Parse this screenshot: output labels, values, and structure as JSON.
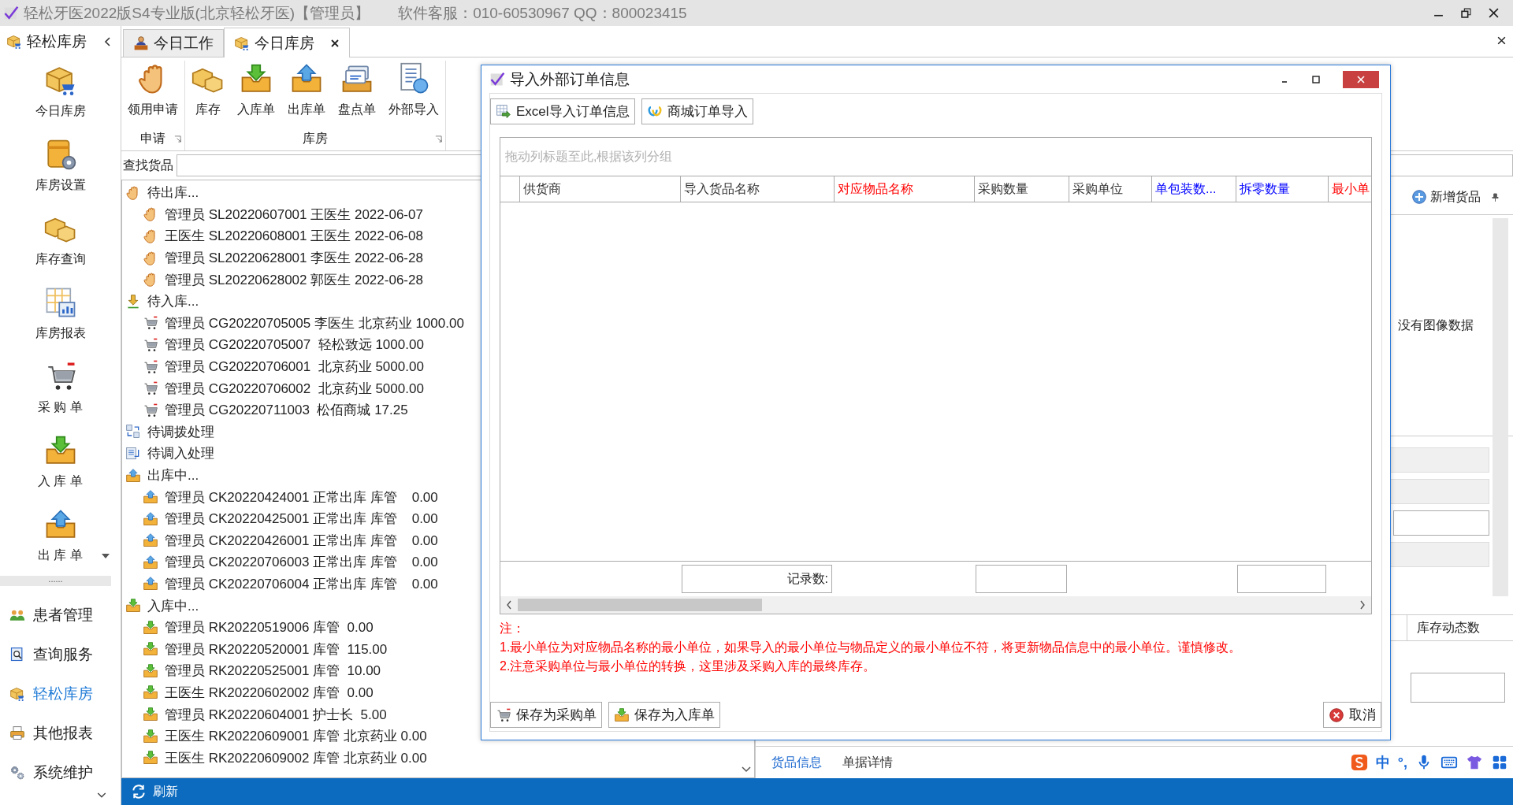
{
  "window": {
    "title": "轻松牙医2022版S4专业版(北京轻松牙医)【管理员】",
    "support": "软件客服：010-60530967  QQ：800023415"
  },
  "sidebar": {
    "header": "轻松库房",
    "big_items": [
      {
        "label": "今日库房",
        "kind": "box-cart",
        "dropdown": false
      },
      {
        "label": "库房设置",
        "kind": "box-gear",
        "dropdown": false
      },
      {
        "label": "库存查询",
        "kind": "boxes",
        "dropdown": false
      },
      {
        "label": "库房报表",
        "kind": "report",
        "dropdown": false
      },
      {
        "label": "采 购 单",
        "kind": "cart",
        "dropdown": false
      },
      {
        "label": "入 库 单",
        "kind": "tray-in",
        "dropdown": false
      },
      {
        "label": "出 库 单",
        "kind": "tray-out",
        "dropdown": true
      }
    ],
    "splitter": "......",
    "nav_items": [
      {
        "label": "患者管理",
        "kind": "people",
        "selected": false
      },
      {
        "label": "查询服务",
        "kind": "search-doc",
        "selected": false
      },
      {
        "label": "轻松库房",
        "kind": "box-cart",
        "selected": true
      },
      {
        "label": "其他报表",
        "kind": "printer",
        "selected": false
      },
      {
        "label": "系统维护",
        "kind": "gears",
        "selected": false
      }
    ]
  },
  "tabs": [
    {
      "label": "今日工作",
      "kind": "person",
      "selected": false,
      "closable": false
    },
    {
      "label": "今日库房",
      "kind": "box-cart",
      "selected": true,
      "closable": true
    }
  ],
  "ribbon": {
    "groups": [
      {
        "title": "申请",
        "buttons": [
          {
            "label": "领用申请",
            "kind": "hand"
          }
        ]
      },
      {
        "title": "库房",
        "buttons": [
          {
            "label": "库存",
            "kind": "boxes"
          },
          {
            "label": "入库单",
            "kind": "tray-in"
          },
          {
            "label": "出库单",
            "kind": "tray-out"
          },
          {
            "label": "盘点单",
            "kind": "tags"
          },
          {
            "label": "外部导入",
            "kind": "doc-circle"
          }
        ]
      }
    ]
  },
  "search": {
    "label": "查找货品"
  },
  "tree": [
    {
      "label": "待出库...",
      "kind": "hand",
      "children": [
        {
          "label": "管理员 SL20220607001 王医生 2022-06-07",
          "kind": "hand"
        },
        {
          "label": "王医生 SL20220608001 王医生 2022-06-08",
          "kind": "hand"
        },
        {
          "label": "管理员 SL20220628001 李医生 2022-06-28",
          "kind": "hand"
        },
        {
          "label": "管理员 SL20220628002 郭医生 2022-06-28",
          "kind": "hand"
        }
      ]
    },
    {
      "label": "待入库...",
      "kind": "download",
      "children": [
        {
          "label": "管理员 CG20220705005 李医生 北京药业 1000.00",
          "kind": "cart"
        },
        {
          "label": "管理员 CG20220705007  轻松致远 1000.00",
          "kind": "cart"
        },
        {
          "label": "管理员 CG20220706001  北京药业 5000.00",
          "kind": "cart"
        },
        {
          "label": "管理员 CG20220706002  北京药业 5000.00",
          "kind": "cart"
        },
        {
          "label": "管理员 CG20220711003  松佰商城 17.25",
          "kind": "cart"
        }
      ]
    },
    {
      "label": "待调拨处理",
      "kind": "transfer"
    },
    {
      "label": "待调入处理",
      "kind": "transfer-in"
    },
    {
      "label": "出库中...",
      "kind": "tray-out",
      "children": [
        {
          "label": "管理员 CK20220424001 正常出库 库管    0.00",
          "kind": "tray-out"
        },
        {
          "label": "管理员 CK20220425001 正常出库 库管    0.00",
          "kind": "tray-out"
        },
        {
          "label": "管理员 CK20220426001 正常出库 库管    0.00",
          "kind": "tray-out"
        },
        {
          "label": "管理员 CK20220706003 正常出库 库管    0.00",
          "kind": "tray-out"
        },
        {
          "label": "管理员 CK20220706004 正常出库 库管    0.00",
          "kind": "tray-out"
        }
      ]
    },
    {
      "label": "入库中...",
      "kind": "tray-in",
      "children": [
        {
          "label": "管理员 RK20220519006 库管  0.00",
          "kind": "tray-in"
        },
        {
          "label": "管理员 RK20220520001 库管  115.00",
          "kind": "tray-in"
        },
        {
          "label": "管理员 RK20220525001 库管  10.00",
          "kind": "tray-in"
        },
        {
          "label": "王医生 RK20220602002 库管  0.00",
          "kind": "tray-in"
        },
        {
          "label": "管理员 RK20220604001 护士长  5.00",
          "kind": "tray-in"
        },
        {
          "label": "王医生 RK20220609001 库管 北京药业 0.00",
          "kind": "tray-in"
        },
        {
          "label": "王医生 RK20220609002 库管 北京药业 0.00",
          "kind": "tray-in"
        }
      ]
    }
  ],
  "right_panel": {
    "add_button": "新增货品",
    "image_text": "没有图像数据",
    "column": "库存动态数",
    "tabs": [
      {
        "label": "货品信息",
        "selected": true
      },
      {
        "label": "单据详情",
        "selected": false
      }
    ]
  },
  "status_bar": {
    "button": "刷新"
  },
  "ime": {
    "texts": [
      "中",
      "°,"
    ]
  },
  "dialog": {
    "title": "导入外部订单信息",
    "toolbar": [
      {
        "label": "Excel导入订单信息",
        "kind": "excel"
      },
      {
        "label": "商城订单导入",
        "kind": "loop"
      }
    ],
    "group_hint": "拖动列标题至此,根据该列分组",
    "columns": [
      {
        "label": "供货商",
        "color": "#333333"
      },
      {
        "label": "导入货品名称",
        "color": "#333333"
      },
      {
        "label": "对应物品名称",
        "color": "#ff0000"
      },
      {
        "label": "采购数量",
        "color": "#333333"
      },
      {
        "label": "采购单位",
        "color": "#333333"
      },
      {
        "label": "单包装数...",
        "color": "#0000ff"
      },
      {
        "label": "拆零数量",
        "color": "#0000ff"
      },
      {
        "label": "最小单",
        "color": "#ff0000"
      }
    ],
    "record_label": "记录数:",
    "notes": [
      "注：",
      "1.最小单位为对应物品名称的最小单位，如果导入的最小单位与物品定义的最小单位不符，将更新物品信息中的最小单位。谨慎修改。",
      "2.注意采购单位与最小单位的转换，这里涉及采购入库的最终库存。"
    ],
    "buttons": [
      {
        "label": "保存为采购单",
        "kind": "cart"
      },
      {
        "label": "保存为入库单",
        "kind": "tray-in"
      },
      {
        "label": "取消",
        "kind": "cancel"
      }
    ]
  }
}
